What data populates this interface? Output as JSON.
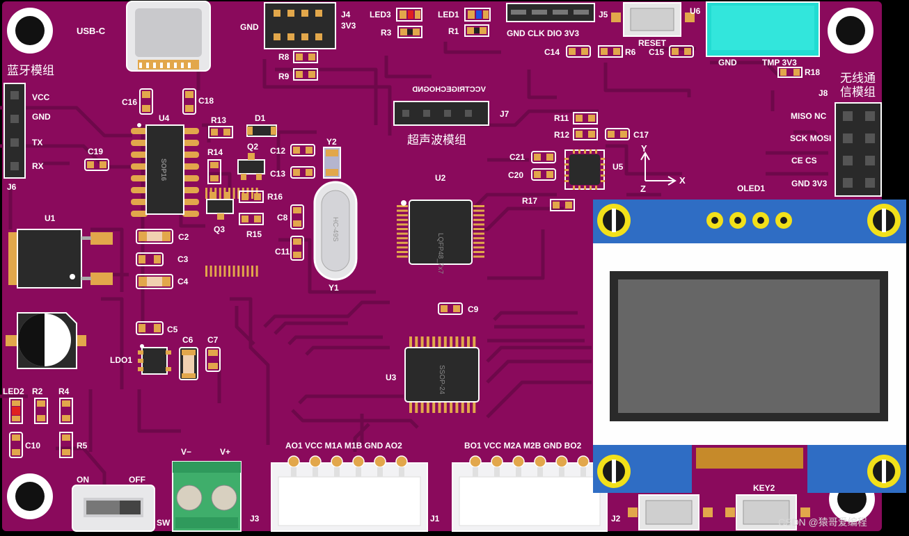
{
  "board": {
    "colors": {
      "soldermask": "#8a0a5c",
      "trace": "#6e084a",
      "pad": "#e2a74b",
      "silkscreen": "#ffffff",
      "oled_pcb": "#2f6dc4",
      "oled_pad": "#f2e01a",
      "ic": "#2a2a2a",
      "terminal": "#3fae6b"
    },
    "mounting_holes": 5
  },
  "labels": {
    "usb_c": "USB-C",
    "bt_module": "蓝牙模组",
    "bt_vcc": "VCC",
    "bt_gnd": "GND",
    "bt_tx": "TX",
    "bt_rx": "RX",
    "j6": "J6",
    "gnd_j4": "GND",
    "j4": "J4",
    "v3_j4": "3V3",
    "led3": "LED3",
    "led1": "LED1",
    "r3": "R3",
    "r1": "R1",
    "j5_pins": "GND CLK DIO 3V3",
    "j5": "J5",
    "u6": "U6",
    "reset": "RESET",
    "c14": "C14",
    "r6": "R6",
    "c15": "C15",
    "r8": "R8",
    "r9": "R9",
    "u6_gnd": "GND",
    "u6_tmp": "TMP 3V3",
    "r18": "R18",
    "wireless": "无线通",
    "wireless2": "信模组",
    "j8": "J8",
    "miso_nc": "MISO NC",
    "sck_mosi": "SCK MOSI",
    "ce_cs": "CE     CS",
    "gnd_3v3": "GND 3V3",
    "oled1": "OLED1",
    "c16": "C16",
    "c18": "C18",
    "u4": "U4",
    "u4_pkg": "SOP16",
    "r13": "R13",
    "d1": "D1",
    "q2": "Q2",
    "r14": "R14",
    "c19": "C19",
    "c12": "C12",
    "y2": "Y2",
    "c13": "C13",
    "j7_pins": "VCCTRIGECHOGND",
    "j7": "J7",
    "ultrasonic": "超声波模组",
    "r11": "R11",
    "r12": "R12",
    "c17": "C17",
    "c21": "C21",
    "c20": "C20",
    "u5": "U5",
    "axis_y": "Y",
    "axis_x": "X",
    "axis_z": "Z",
    "r17": "R17",
    "u2": "U2",
    "u2_pkg": "LQFP48_7x7",
    "r16": "R16",
    "q3": "Q3",
    "r15": "R15",
    "c8": "C8",
    "c11": "C11",
    "y1_pkg": "HC-49S",
    "y1": "Y1",
    "u1": "U1",
    "c2": "C2",
    "c3": "C3",
    "c4": "C4",
    "c9": "C9",
    "c5": "C5",
    "c6": "C6",
    "c7": "C7",
    "ldo1": "LDO1",
    "u3": "U3",
    "u3_pkg": "SSOP-24",
    "led2": "LED2",
    "r2": "R2",
    "r4": "R4",
    "c10": "C10",
    "r5": "R5",
    "on": "ON",
    "off": "OFF",
    "sw": "SW",
    "v_minus": "V−",
    "v_plus": "V+",
    "j3": "J3",
    "j1_pins": "AO1 VCC M1A M1B GND AO2",
    "j1": "J1",
    "j2_pins": "BO1 VCC M2A M2B GND BO2",
    "j2": "J2",
    "key2": "KEY2",
    "watermark": "CSDN @猿哥爱编程"
  }
}
